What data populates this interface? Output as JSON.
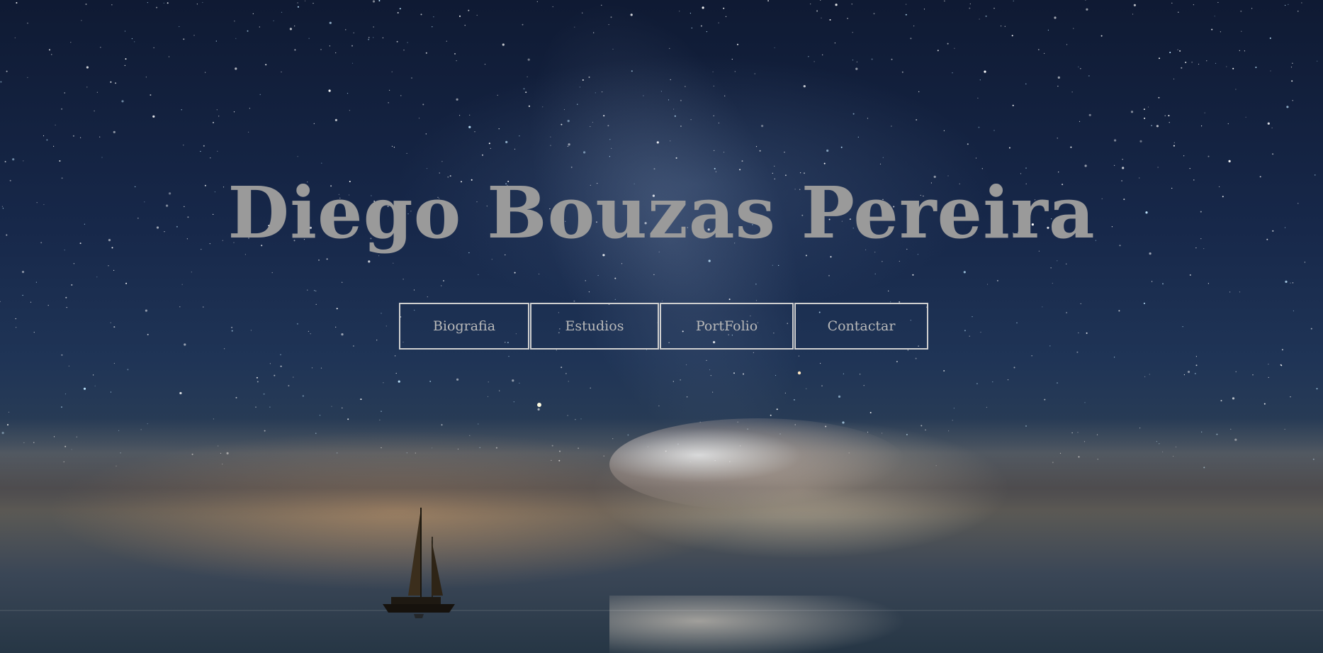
{
  "site": {
    "title": "Diego Bouzas Pereira"
  },
  "nav": {
    "items": [
      {
        "label": "Biografia"
      },
      {
        "label": "Estudios"
      },
      {
        "label": "PortFolio"
      },
      {
        "label": "Contactar"
      }
    ]
  },
  "colors": {
    "title": "#9a9a9a",
    "nav_text": "#b9b9b9",
    "nav_border": "#cfcfcf",
    "sky_top": "#0f1a33"
  }
}
